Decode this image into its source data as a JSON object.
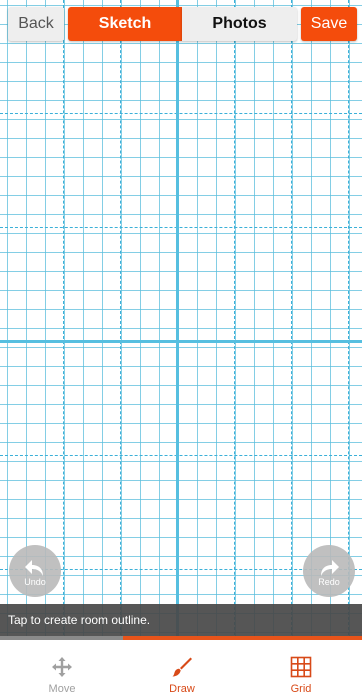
{
  "header": {
    "back_label": "Back",
    "tabs": [
      {
        "label": "Sketch",
        "active": true
      },
      {
        "label": "Photos",
        "active": false
      }
    ],
    "save_label": "Save"
  },
  "canvas": {
    "undo_label": "Undo",
    "redo_label": "Redo",
    "hint": "Tap to create room outline."
  },
  "bottom_nav": {
    "items": [
      {
        "label": "Move",
        "icon": "move-icon",
        "active": false
      },
      {
        "label": "Draw",
        "icon": "brush-icon",
        "active": true
      },
      {
        "label": "Grid",
        "icon": "grid-icon",
        "active": true
      }
    ]
  },
  "colors": {
    "accent": "#f44c0c",
    "grid_line": "#5abedc",
    "inactive": "#a0a0a0"
  }
}
